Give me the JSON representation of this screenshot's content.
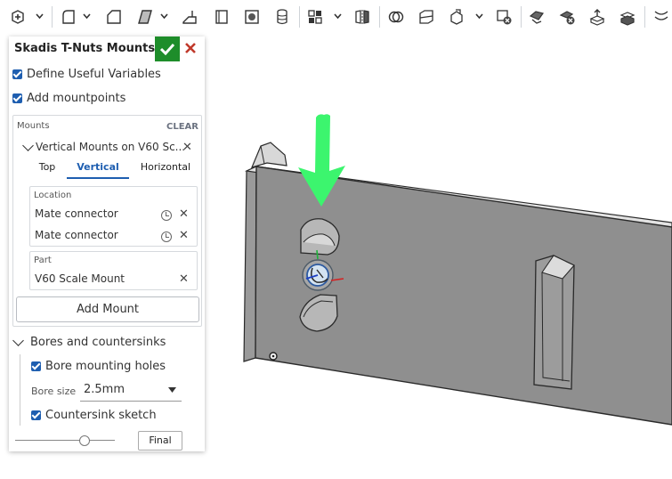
{
  "toolbar": {
    "icons": [
      "new-part-icon",
      "fillet-icon",
      "chamfer-icon",
      "draft-icon",
      "shell-icon",
      "rib-icon",
      "hole-icon",
      "thread-icon",
      "pattern-icon",
      "mirror-icon",
      "boolean-icon",
      "split-icon",
      "transform-icon",
      "delete-part-icon",
      "modify-face-icon",
      "delete-face-icon",
      "move-face-icon",
      "replace-face-icon",
      "offset-surface-icon"
    ]
  },
  "feature_panel": {
    "title": "Skadis T-Nuts Mounts 1",
    "define_useful_variables_label": "Define Useful Variables",
    "add_mountpoints_label": "Add mountpoints",
    "mounts": {
      "label": "Mounts",
      "clear_label": "CLEAR",
      "item_title": "Vertical Mounts on V60 Sc...",
      "tabs": [
        "Top",
        "Vertical",
        "Horizontal"
      ],
      "active_tab": "Vertical",
      "location_label": "Location",
      "location_items": [
        "Mate connector",
        "Mate connector"
      ],
      "part_label": "Part",
      "part_value": "V60 Scale Mount"
    },
    "add_mount_label": "Add Mount",
    "bores_section_label": "Bores and countersinks",
    "bore_mounting_holes_label": "Bore mounting holes",
    "bore_size_label": "Bore size",
    "bore_size_value": "2.5mm",
    "countersink_sketch_label": "Countersink sketch",
    "slider_level": 0.7,
    "final_label": "Final"
  },
  "colors": {
    "accent": "#1e5eb0",
    "ok_green": "#1e8d2a",
    "cancel_red": "#c0392b",
    "arrow_green": "#3cf56e",
    "part_grey": "#8f8f8f"
  }
}
